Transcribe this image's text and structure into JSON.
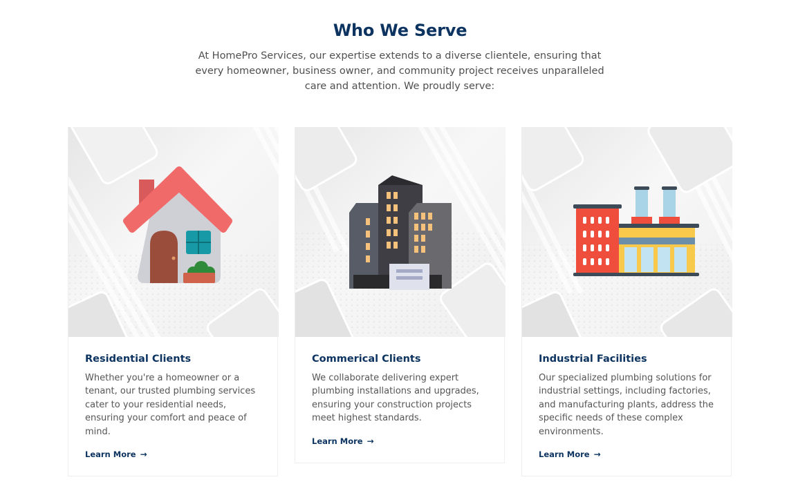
{
  "section": {
    "title": "Who We Serve",
    "intro": "At HomePro Services, our expertise extends to a diverse clientele, ensuring that every homeowner, business owner, and community project receives unparalleled care and attention. We proudly serve:"
  },
  "cards": [
    {
      "title": "Residential Clients",
      "text": "Whether you're a homeowner or a tenant, our trusted plumbing services cater to your residential needs, ensuring your comfort and peace of mind.",
      "link": "Learn More",
      "icon": "house-icon"
    },
    {
      "title": "Commerical Clients",
      "text": "We collaborate delivering expert plumbing installations and upgrades, ensuring your construction projects meet highest standards.",
      "link": "Learn More",
      "icon": "office-buildings-icon"
    },
    {
      "title": "Industrial Facilities",
      "text": "Our specialized plumbing solutions for industrial settings, including factories, and manufacturing plants, address the specific needs of these complex environments.",
      "link": "Learn More",
      "icon": "factory-icon"
    }
  ],
  "colors": {
    "heading": "#0d3461",
    "body_text": "#555555",
    "card_border": "#eeeeee"
  }
}
